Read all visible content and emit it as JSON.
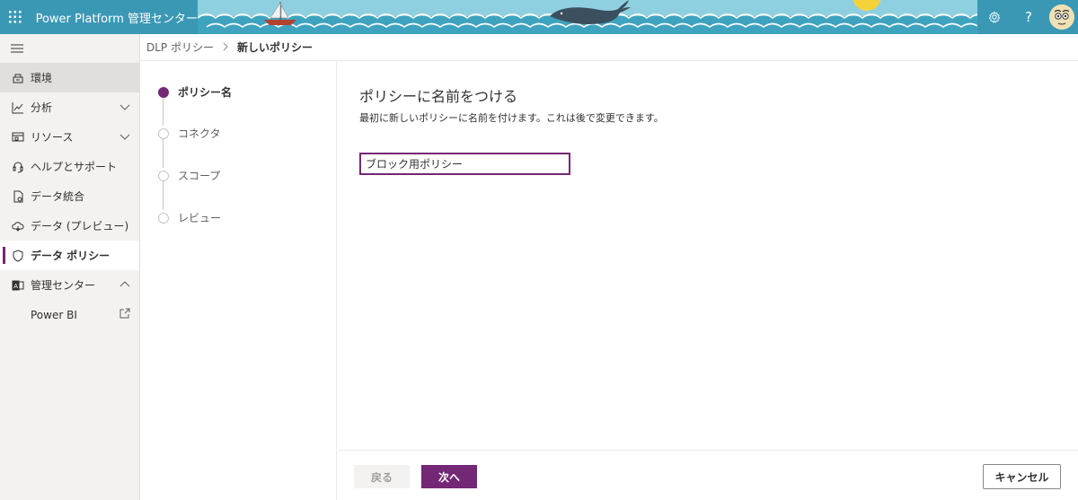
{
  "header": {
    "app_title": "Power Platform 管理センター",
    "icons": [
      "waffle-icon",
      "gear-icon",
      "help-icon",
      "avatar"
    ],
    "help_label": "?",
    "brand_color": "#3a98b5"
  },
  "sidebar": {
    "items": [
      {
        "label": "環境",
        "icon": "environments-icon"
      },
      {
        "label": "分析",
        "icon": "analytics-icon"
      },
      {
        "label": "リソース",
        "icon": "resources-icon"
      },
      {
        "label": "ヘルプとサポート",
        "icon": "headset-icon"
      },
      {
        "label": "データ統合",
        "icon": "data-integration-icon"
      },
      {
        "label": "データ (プレビュー)",
        "icon": "cloud-data-icon"
      },
      {
        "label": "データ ポリシー",
        "icon": "shield-icon"
      },
      {
        "label": "管理センター",
        "icon": "admin-center-icon"
      },
      {
        "label": "Power BI",
        "icon": "external-link-icon"
      }
    ]
  },
  "breadcrumb": {
    "parent": "DLP ポリシー",
    "current": "新しいポリシー"
  },
  "stepper": {
    "steps": [
      "ポリシー名",
      "コネクタ",
      "スコープ",
      "レビュー"
    ],
    "current_index": 0,
    "accent": "#742774"
  },
  "main": {
    "title": "ポリシーに名前をつける",
    "description": "最初に新しいポリシーに名前を付けます。これは後で変更できます。",
    "name_value": "ブロック用ポリシー"
  },
  "footer": {
    "back_label": "戻る",
    "next_label": "次へ",
    "cancel_label": "キャンセル"
  }
}
